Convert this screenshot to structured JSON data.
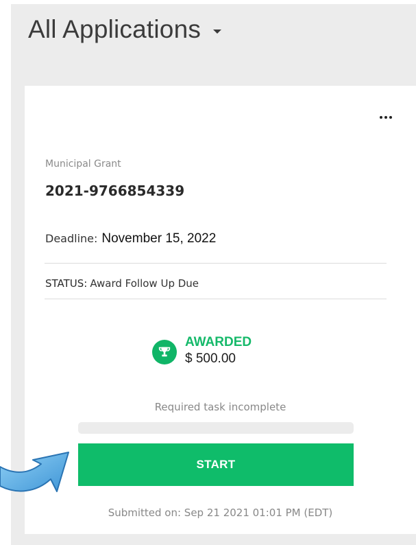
{
  "header": {
    "title": "All Applications"
  },
  "card": {
    "category": "Municipal Grant",
    "application_id": "2021-9766854339",
    "deadline": {
      "label": "Deadline:",
      "value": "November 15, 2022"
    },
    "status": {
      "label": "STATUS:",
      "value": "Award Follow Up Due"
    },
    "award": {
      "icon": "trophy-icon",
      "status": "AWARDED",
      "amount": "$ 500.00"
    },
    "task": {
      "text": "Required task incomplete",
      "progress_percent": 0
    },
    "start_label": "START",
    "submitted": "Submitted on: Sep 21 2021 01:01 PM (EDT)"
  },
  "colors": {
    "accent_green": "#0fbc6a",
    "panel_bg": "#ececec",
    "arrow_blue": "#4aa3df"
  }
}
